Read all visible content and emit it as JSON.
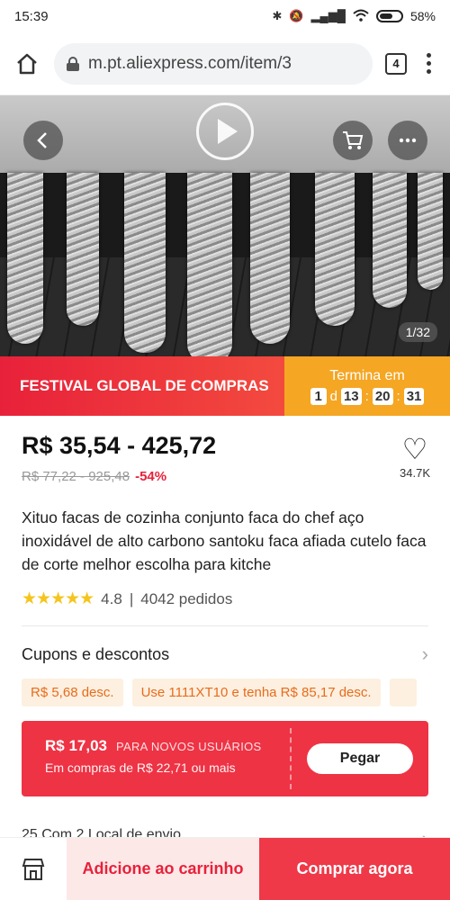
{
  "status_bar": {
    "time": "15:39",
    "battery": "58%"
  },
  "browser": {
    "url": "m.pt.aliexpress.com/item/3",
    "tab_count": "4"
  },
  "gallery": {
    "counter": "1/32"
  },
  "promo": {
    "festival_label": "FESTIVAL GLOBAL DE COMPRAS",
    "ends_label": "Termina em",
    "days": "1",
    "days_unit": "d",
    "hours": "13",
    "minutes": "20",
    "seconds": "31"
  },
  "product": {
    "price_range": "R$ 35,54 - 425,72",
    "old_price_range": "R$ 77,22 - 925,48",
    "discount": "-54%",
    "wishlist_count": "34.7K",
    "title": "Xituo facas de cozinha conjunto faca do chef aço inoxidável de alto carbono santoku faca afiada cutelo faca de corte melhor escolha para kitche",
    "rating": "4.8",
    "orders": "4042 pedidos"
  },
  "coupons": {
    "header": "Cupons e descontos",
    "chips": [
      "R$ 5,68 desc.",
      "Use 1111XT10 e tenha R$ 85,17 desc.",
      ""
    ]
  },
  "new_user": {
    "amount": "R$ 17,03",
    "tag": "PARA NOVOS USUÁRIOS",
    "condition": "Em compras de R$ 22,71 ou mais",
    "claim_label": "Pegar"
  },
  "shipping": {
    "peek_text": "25 Com 2 Local de envio"
  },
  "bottom_bar": {
    "add_to_cart": "Adicione ao carrinho",
    "buy_now": "Comprar agora"
  },
  "colors": {
    "accent_red": "#e8213a",
    "promo_orange": "#f5a623",
    "coupon_bg": "#fdf0e0",
    "coupon_text": "#e86b1c"
  },
  "icons": [
    "wifi-icon",
    "signal-icon",
    "bluetooth-icon",
    "mute-icon",
    "home-icon",
    "lock-icon",
    "back-icon",
    "play-icon",
    "cart-icon",
    "more-icon",
    "heart-icon",
    "star-icon",
    "chevron-right-icon",
    "store-icon"
  ]
}
